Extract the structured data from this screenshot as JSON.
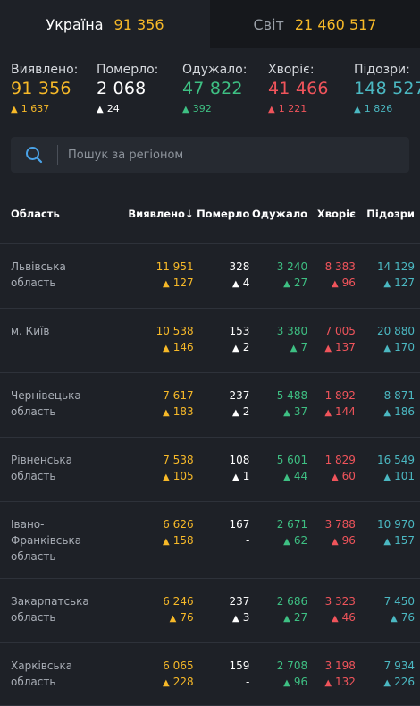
{
  "tabs": [
    {
      "label": "Україна",
      "value": "91 356"
    },
    {
      "label": "Світ",
      "value": "21 460 517"
    }
  ],
  "stats": [
    {
      "title": "Виявлено:",
      "value": "91 356",
      "delta": "1 637",
      "color": "yellow"
    },
    {
      "title": "Померло:",
      "value": "2 068",
      "delta": "24",
      "color": "white"
    },
    {
      "title": "Одужало:",
      "value": "47 822",
      "delta": "392",
      "color": "green"
    },
    {
      "title": "Хворіє:",
      "value": "41 466",
      "delta": "1 221",
      "color": "red"
    },
    {
      "title": "Підозри:",
      "value": "148 527",
      "delta": "1 826",
      "color": "teal"
    }
  ],
  "search": {
    "placeholder": "Пошук за регіоном"
  },
  "table": {
    "headers": [
      "Область",
      "Виявлено",
      "Померло",
      "Одужало",
      "Хворіє",
      "Підозри"
    ],
    "sort_indicator": "↓",
    "rows": [
      {
        "region": "Львівська область",
        "cases": "11 951",
        "cases_d": "127",
        "deaths": "328",
        "deaths_d": "4",
        "recovered": "3 240",
        "recovered_d": "27",
        "sick": "8 383",
        "sick_d": "96",
        "suspected": "14 129",
        "suspected_d": "127"
      },
      {
        "region": "м. Київ",
        "cases": "10 538",
        "cases_d": "146",
        "deaths": "153",
        "deaths_d": "2",
        "recovered": "3 380",
        "recovered_d": "7",
        "sick": "7 005",
        "sick_d": "137",
        "suspected": "20 880",
        "suspected_d": "170"
      },
      {
        "region": "Чернівецька область",
        "cases": "7 617",
        "cases_d": "183",
        "deaths": "237",
        "deaths_d": "2",
        "recovered": "5 488",
        "recovered_d": "37",
        "sick": "1 892",
        "sick_d": "144",
        "suspected": "8 871",
        "suspected_d": "186"
      },
      {
        "region": "Рівненська область",
        "cases": "7 538",
        "cases_d": "105",
        "deaths": "108",
        "deaths_d": "1",
        "recovered": "5 601",
        "recovered_d": "44",
        "sick": "1 829",
        "sick_d": "60",
        "suspected": "16 549",
        "suspected_d": "101"
      },
      {
        "region": "Івано-Франківська область",
        "cases": "6 626",
        "cases_d": "158",
        "deaths": "167",
        "deaths_d": "-",
        "recovered": "2 671",
        "recovered_d": "62",
        "sick": "3 788",
        "sick_d": "96",
        "suspected": "10 970",
        "suspected_d": "157"
      },
      {
        "region": "Закарпатська область",
        "cases": "6 246",
        "cases_d": "76",
        "deaths": "237",
        "deaths_d": "3",
        "recovered": "2 686",
        "recovered_d": "27",
        "sick": "3 323",
        "sick_d": "46",
        "suspected": "7 450",
        "suspected_d": "76"
      },
      {
        "region": "Харківська область",
        "cases": "6 065",
        "cases_d": "228",
        "deaths": "159",
        "deaths_d": "-",
        "recovered": "2 708",
        "recovered_d": "96",
        "sick": "3 198",
        "sick_d": "132",
        "suspected": "7 934",
        "suspected_d": "226"
      }
    ]
  },
  "colors": {
    "yellow": "#f7b928",
    "white": "#ffffff",
    "green": "#3ec083",
    "red": "#f0545b",
    "teal": "#4bb8c2"
  },
  "icons": {
    "search": "search-icon",
    "up": "arrow-up-icon"
  }
}
